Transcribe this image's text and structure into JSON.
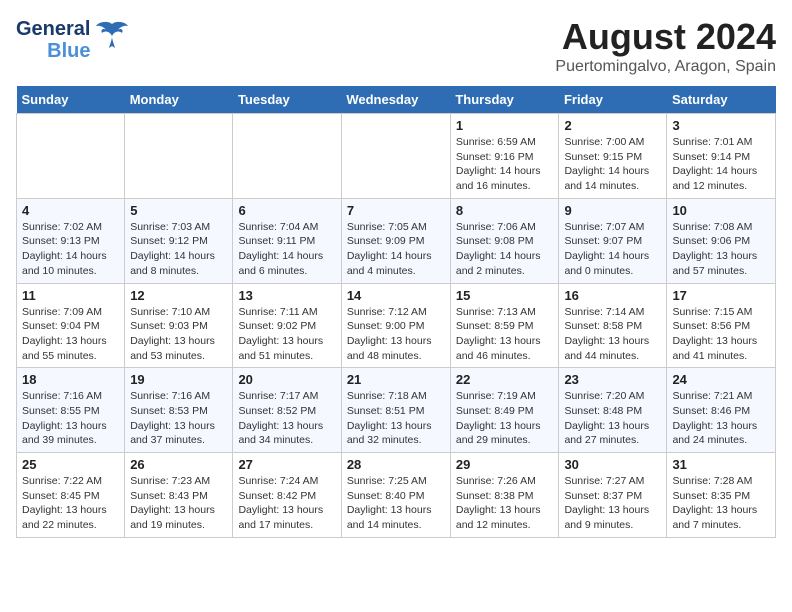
{
  "header": {
    "logo_line1": "General",
    "logo_line2": "Blue",
    "month_year": "August 2024",
    "location": "Puertomingalvo, Aragon, Spain"
  },
  "weekdays": [
    "Sunday",
    "Monday",
    "Tuesday",
    "Wednesday",
    "Thursday",
    "Friday",
    "Saturday"
  ],
  "weeks": [
    [
      {
        "day": "",
        "info": ""
      },
      {
        "day": "",
        "info": ""
      },
      {
        "day": "",
        "info": ""
      },
      {
        "day": "",
        "info": ""
      },
      {
        "day": "1",
        "info": "Sunrise: 6:59 AM\nSunset: 9:16 PM\nDaylight: 14 hours\nand 16 minutes."
      },
      {
        "day": "2",
        "info": "Sunrise: 7:00 AM\nSunset: 9:15 PM\nDaylight: 14 hours\nand 14 minutes."
      },
      {
        "day": "3",
        "info": "Sunrise: 7:01 AM\nSunset: 9:14 PM\nDaylight: 14 hours\nand 12 minutes."
      }
    ],
    [
      {
        "day": "4",
        "info": "Sunrise: 7:02 AM\nSunset: 9:13 PM\nDaylight: 14 hours\nand 10 minutes."
      },
      {
        "day": "5",
        "info": "Sunrise: 7:03 AM\nSunset: 9:12 PM\nDaylight: 14 hours\nand 8 minutes."
      },
      {
        "day": "6",
        "info": "Sunrise: 7:04 AM\nSunset: 9:11 PM\nDaylight: 14 hours\nand 6 minutes."
      },
      {
        "day": "7",
        "info": "Sunrise: 7:05 AM\nSunset: 9:09 PM\nDaylight: 14 hours\nand 4 minutes."
      },
      {
        "day": "8",
        "info": "Sunrise: 7:06 AM\nSunset: 9:08 PM\nDaylight: 14 hours\nand 2 minutes."
      },
      {
        "day": "9",
        "info": "Sunrise: 7:07 AM\nSunset: 9:07 PM\nDaylight: 14 hours\nand 0 minutes."
      },
      {
        "day": "10",
        "info": "Sunrise: 7:08 AM\nSunset: 9:06 PM\nDaylight: 13 hours\nand 57 minutes."
      }
    ],
    [
      {
        "day": "11",
        "info": "Sunrise: 7:09 AM\nSunset: 9:04 PM\nDaylight: 13 hours\nand 55 minutes."
      },
      {
        "day": "12",
        "info": "Sunrise: 7:10 AM\nSunset: 9:03 PM\nDaylight: 13 hours\nand 53 minutes."
      },
      {
        "day": "13",
        "info": "Sunrise: 7:11 AM\nSunset: 9:02 PM\nDaylight: 13 hours\nand 51 minutes."
      },
      {
        "day": "14",
        "info": "Sunrise: 7:12 AM\nSunset: 9:00 PM\nDaylight: 13 hours\nand 48 minutes."
      },
      {
        "day": "15",
        "info": "Sunrise: 7:13 AM\nSunset: 8:59 PM\nDaylight: 13 hours\nand 46 minutes."
      },
      {
        "day": "16",
        "info": "Sunrise: 7:14 AM\nSunset: 8:58 PM\nDaylight: 13 hours\nand 44 minutes."
      },
      {
        "day": "17",
        "info": "Sunrise: 7:15 AM\nSunset: 8:56 PM\nDaylight: 13 hours\nand 41 minutes."
      }
    ],
    [
      {
        "day": "18",
        "info": "Sunrise: 7:16 AM\nSunset: 8:55 PM\nDaylight: 13 hours\nand 39 minutes."
      },
      {
        "day": "19",
        "info": "Sunrise: 7:16 AM\nSunset: 8:53 PM\nDaylight: 13 hours\nand 37 minutes."
      },
      {
        "day": "20",
        "info": "Sunrise: 7:17 AM\nSunset: 8:52 PM\nDaylight: 13 hours\nand 34 minutes."
      },
      {
        "day": "21",
        "info": "Sunrise: 7:18 AM\nSunset: 8:51 PM\nDaylight: 13 hours\nand 32 minutes."
      },
      {
        "day": "22",
        "info": "Sunrise: 7:19 AM\nSunset: 8:49 PM\nDaylight: 13 hours\nand 29 minutes."
      },
      {
        "day": "23",
        "info": "Sunrise: 7:20 AM\nSunset: 8:48 PM\nDaylight: 13 hours\nand 27 minutes."
      },
      {
        "day": "24",
        "info": "Sunrise: 7:21 AM\nSunset: 8:46 PM\nDaylight: 13 hours\nand 24 minutes."
      }
    ],
    [
      {
        "day": "25",
        "info": "Sunrise: 7:22 AM\nSunset: 8:45 PM\nDaylight: 13 hours\nand 22 minutes."
      },
      {
        "day": "26",
        "info": "Sunrise: 7:23 AM\nSunset: 8:43 PM\nDaylight: 13 hours\nand 19 minutes."
      },
      {
        "day": "27",
        "info": "Sunrise: 7:24 AM\nSunset: 8:42 PM\nDaylight: 13 hours\nand 17 minutes."
      },
      {
        "day": "28",
        "info": "Sunrise: 7:25 AM\nSunset: 8:40 PM\nDaylight: 13 hours\nand 14 minutes."
      },
      {
        "day": "29",
        "info": "Sunrise: 7:26 AM\nSunset: 8:38 PM\nDaylight: 13 hours\nand 12 minutes."
      },
      {
        "day": "30",
        "info": "Sunrise: 7:27 AM\nSunset: 8:37 PM\nDaylight: 13 hours\nand 9 minutes."
      },
      {
        "day": "31",
        "info": "Sunrise: 7:28 AM\nSunset: 8:35 PM\nDaylight: 13 hours\nand 7 minutes."
      }
    ]
  ]
}
